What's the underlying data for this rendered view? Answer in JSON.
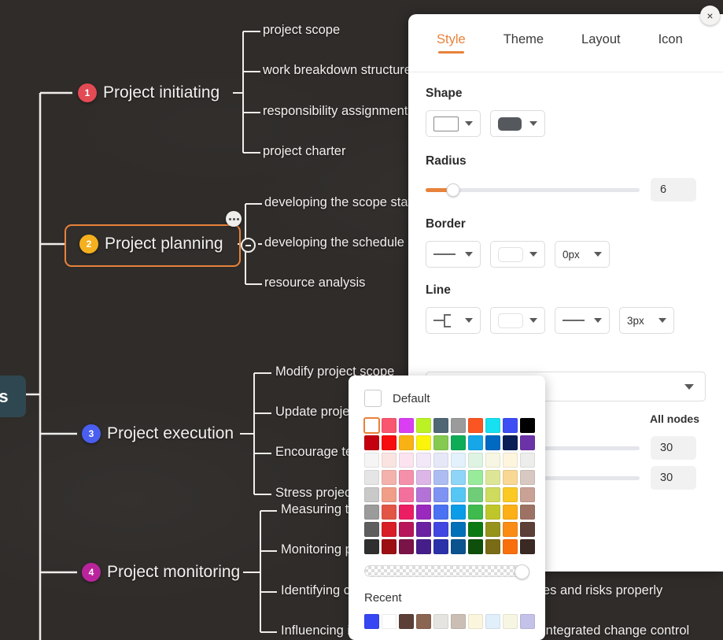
{
  "canvas": {
    "root_node": {
      "label": "s",
      "color": "#2f4750"
    },
    "branches": [
      {
        "index": "1",
        "label": "Project initiating",
        "badge_color": "#e24a54",
        "children": [
          "project scope",
          "work breakdown structure",
          "responsibility assignment",
          "project charter"
        ]
      },
      {
        "index": "2",
        "label": "Project planning",
        "badge_color": "#f5b01e",
        "selected": true,
        "children": [
          "developing the scope statement",
          "developing the schedule",
          "resource analysis"
        ]
      },
      {
        "index": "3",
        "label": "Project execution",
        "badge_color": "#4a5ef0",
        "children": [
          "Modify project scope",
          "Update project plan",
          "Encourage team",
          "Stress project quality"
        ]
      },
      {
        "index": "4",
        "label": "Project monitoring",
        "badge_color": "#b9249c",
        "children": [
          "Measuring the performance",
          "Monitoring project",
          "Identifying changes and risks properly",
          "Influencing integrated change control"
        ]
      }
    ],
    "overflow_text": [
      "es and risks properly",
      "integrated change control"
    ]
  },
  "panel": {
    "close_icon": "×",
    "tabs": [
      {
        "label": "Style",
        "active": true
      },
      {
        "label": "Theme",
        "active": false
      },
      {
        "label": "Layout",
        "active": false
      },
      {
        "label": "Icon",
        "active": false
      }
    ],
    "shape": {
      "title": "Shape",
      "outline_shape_icon": "rectangle-outline-icon",
      "fill_shape_icon": "rounded-rect-filled-icon",
      "fill_color": "#55585c"
    },
    "radius": {
      "title": "Radius",
      "value": "6",
      "percent": 13
    },
    "border": {
      "title": "Border",
      "style_icon": "solid-line-icon",
      "color_swatch": "#ffffff",
      "width_label": "0px"
    },
    "line": {
      "title": "Line",
      "shape_icon": "elbow-connector-icon",
      "color_swatch": "#ffffff",
      "style_icon": "solid-line-icon",
      "width_label": "3px"
    },
    "scope_label": "All nodes",
    "sliders": [
      {
        "value": "30",
        "percent": 12
      },
      {
        "value": "30",
        "percent": 25
      }
    ],
    "accent_color": "#e8823a"
  },
  "color_picker": {
    "default_label": "Default",
    "selected_index": 0,
    "swatches": [
      "#ffffff",
      "#f9566f",
      "#d93ef2",
      "#bbf226",
      "#4f6675",
      "#9b9b9b",
      "#fa5522",
      "#17e0f0",
      "#3d4ef5",
      "#000000",
      "#c30010",
      "#f60d0d",
      "#f9b214",
      "#fbf40b",
      "#85c951",
      "#0eac57",
      "#16a7e8",
      "#0069c2",
      "#0a1f56",
      "#6c33a8",
      "#f5f5f5",
      "#fae4e1",
      "#fbe3ef",
      "#f2e8f7",
      "#e6e8f7",
      "#e2f1fb",
      "#dff3e3",
      "#f6f6e3",
      "#fdf5de",
      "#ededeb",
      "#e5e5e5",
      "#f4b2ac",
      "#f590ab",
      "#dcb6e6",
      "#adbdf2",
      "#8fd5f7",
      "#98eb9b",
      "#dde697",
      "#f9d794",
      "#d7c9c2",
      "#c9c9c9",
      "#f09e88",
      "#f2709b",
      "#b372d6",
      "#7f93f2",
      "#56c6f5",
      "#6fcd77",
      "#cedb5f",
      "#fbc824",
      "#c9a195",
      "#9b9b9b",
      "#e25645",
      "#ec1e63",
      "#9a29be",
      "#4a72f2",
      "#0b9ce8",
      "#3fba4d",
      "#bfc62a",
      "#fcaf17",
      "#9d7265",
      "#5e5e5e",
      "#d81e26",
      "#b7175a",
      "#6a22a3",
      "#4147e0",
      "#0371b8",
      "#0c7a13",
      "#95931c",
      "#fa8c16",
      "#5c4038",
      "#2f2f2f",
      "#9b0f12",
      "#7a1347",
      "#461e89",
      "#2b31a8",
      "#0a538f",
      "#0f4f0c",
      "#7a6b16",
      "#f96f0e",
      "#3b2923"
    ],
    "recent_title": "Recent",
    "recent": [
      "#3646f2",
      "#ffffff",
      "#5c4038",
      "#8a6552",
      "#e6e4e1",
      "#cbbfb5",
      "#faf5dc",
      "#e0effa",
      "#f6f6e3",
      "#c4c2e8"
    ]
  }
}
